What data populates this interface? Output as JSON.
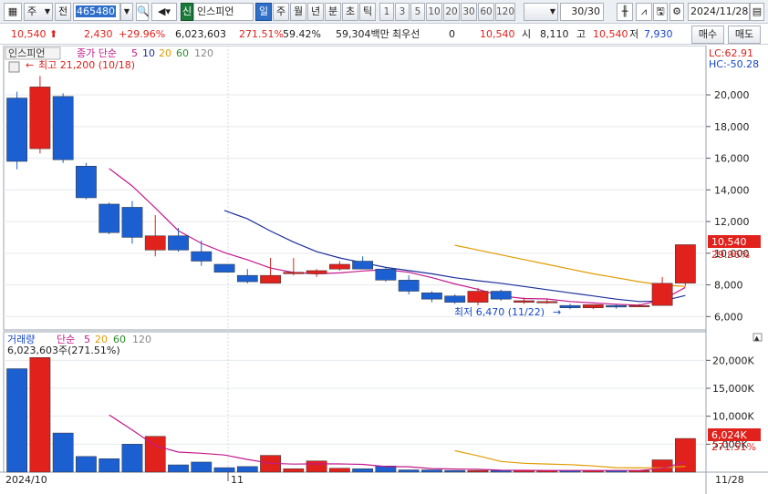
{
  "toolbar": {
    "type_label": "주",
    "prev_label": "전",
    "stock_code": "465480",
    "stock_badge": "신",
    "stock_name": "인스피언",
    "period_tabs": [
      "일",
      "주",
      "월",
      "년",
      "분",
      "초",
      "틱"
    ],
    "period_active": "일",
    "interval_buttons": [
      "1",
      "3",
      "5",
      "10",
      "20",
      "30",
      "60",
      "120"
    ],
    "count_display": "30/30",
    "date_value": "2024/11/28"
  },
  "quote": {
    "price": "10,540",
    "change": "2,430",
    "change_pct": "+29.96%",
    "volume": "6,023,603",
    "volume_ratio": "271.51%",
    "turnover": "59.42%",
    "amount": "59,304백만",
    "priority_label": "최우선",
    "priority_value": "0",
    "bid": "10,540",
    "open_label": "시",
    "open": "8,110",
    "high_label": "고",
    "high": "10,540",
    "low_label": "저",
    "low": "7,930",
    "buy_label": "매수",
    "sell_label": "매도"
  },
  "price_panel": {
    "name_tag": "인스피언",
    "ma_label": "종가 단순",
    "ma_periods": [
      "5",
      "10",
      "20",
      "60",
      "120"
    ],
    "ma_colors": [
      "#c4198c",
      "#1c2f9c",
      "#e29b00",
      "#2d8b2d",
      "#888888"
    ],
    "high_annotation": "최고 21,200 (10/18)",
    "low_annotation": "최저 6,470 (11/22)",
    "lc_label": "LC:62.91",
    "hc_label": "HC:-50.28",
    "y_ticks": [
      "20,000",
      "18,000",
      "16,000",
      "14,000",
      "12,000",
      "10,000",
      "8,000",
      "6,000"
    ],
    "last_price_tag": "10,540",
    "last_pct_tag": "29.96%"
  },
  "volume_panel": {
    "title": "거래량",
    "ma_label": "단순",
    "ma_periods": [
      "5",
      "20",
      "60",
      "120"
    ],
    "volume_annotation": "6,023,603주(271.51%)",
    "y_ticks": [
      "20,000K",
      "15,000K",
      "10,000K",
      "5,000K"
    ],
    "last_vol_tag": "6,024K",
    "last_pct_tag": "271.51%"
  },
  "x_axis": {
    "labels": [
      "2024/10",
      "11",
      "11/28"
    ]
  },
  "chart_data": {
    "type": "candlestick",
    "candles": [
      {
        "o": 19800,
        "h": 20200,
        "l": 15300,
        "c": 15800,
        "v": 18500
      },
      {
        "o": 16600,
        "h": 21200,
        "l": 16300,
        "c": 20500,
        "v": 20500
      },
      {
        "o": 19900,
        "h": 20100,
        "l": 15700,
        "c": 15900,
        "v": 7000
      },
      {
        "o": 15500,
        "h": 15700,
        "l": 13400,
        "c": 13500,
        "v": 2800
      },
      {
        "o": 13100,
        "h": 13200,
        "l": 11200,
        "c": 11300,
        "v": 2400
      },
      {
        "o": 12900,
        "h": 13300,
        "l": 10600,
        "c": 11000,
        "v": 5000
      },
      {
        "o": 10200,
        "h": 12400,
        "l": 9800,
        "c": 11100,
        "v": 6400
      },
      {
        "o": 11100,
        "h": 11600,
        "l": 10100,
        "c": 10200,
        "v": 1300
      },
      {
        "o": 10100,
        "h": 10800,
        "l": 9200,
        "c": 9500,
        "v": 1800
      },
      {
        "o": 9300,
        "h": 9300,
        "l": 8800,
        "c": 8800,
        "v": 800
      },
      {
        "o": 8600,
        "h": 9000,
        "l": 8100,
        "c": 8200,
        "v": 1000
      },
      {
        "o": 8100,
        "h": 9700,
        "l": 8100,
        "c": 8600,
        "v": 3000
      },
      {
        "o": 8700,
        "h": 9700,
        "l": 8600,
        "c": 8800,
        "v": 600
      },
      {
        "o": 8700,
        "h": 9000,
        "l": 8500,
        "c": 8900,
        "v": 2000
      },
      {
        "o": 9000,
        "h": 9500,
        "l": 8900,
        "c": 9300,
        "v": 700
      },
      {
        "o": 9500,
        "h": 9800,
        "l": 9000,
        "c": 9000,
        "v": 600
      },
      {
        "o": 9000,
        "h": 9100,
        "l": 8200,
        "c": 8300,
        "v": 1100
      },
      {
        "o": 8300,
        "h": 8600,
        "l": 7400,
        "c": 7600,
        "v": 400
      },
      {
        "o": 7500,
        "h": 7600,
        "l": 6900,
        "c": 7100,
        "v": 400
      },
      {
        "o": 7300,
        "h": 7400,
        "l": 6800,
        "c": 6900,
        "v": 300
      },
      {
        "o": 6900,
        "h": 7800,
        "l": 6700,
        "c": 7600,
        "v": 300
      },
      {
        "o": 7600,
        "h": 7700,
        "l": 7000,
        "c": 7100,
        "v": 300
      },
      {
        "o": 6900,
        "h": 7200,
        "l": 6800,
        "c": 7000,
        "v": 300
      },
      {
        "o": 6950,
        "h": 7100,
        "l": 6800,
        "c": 6950,
        "v": 300
      },
      {
        "o": 6700,
        "h": 6800,
        "l": 6470,
        "c": 6550,
        "v": 300
      },
      {
        "o": 6550,
        "h": 6750,
        "l": 6470,
        "c": 6750,
        "v": 300
      },
      {
        "o": 6700,
        "h": 6800,
        "l": 6500,
        "c": 6600,
        "v": 300
      },
      {
        "o": 6650,
        "h": 6800,
        "l": 6600,
        "c": 6700,
        "v": 300
      },
      {
        "o": 6700,
        "h": 8500,
        "l": 6700,
        "c": 8100,
        "v": 2200
      },
      {
        "o": 8110,
        "h": 10540,
        "l": 7930,
        "c": 10540,
        "v": 6024
      }
    ],
    "ma5": [
      null,
      null,
      null,
      null,
      15350,
      14240,
      12860,
      11420,
      10620,
      10040,
      9580,
      9060,
      8780,
      8700,
      8760,
      8880,
      8960,
      8800,
      8460,
      8060,
      7720,
      7300,
      7140,
      7110,
      6950,
      6860,
      6780,
      6720,
      7050,
      7840
    ],
    "ma10": [
      null,
      null,
      null,
      null,
      null,
      null,
      null,
      null,
      null,
      12700,
      12170,
      11400,
      10700,
      10100,
      9700,
      9400,
      9100,
      8900,
      8700,
      8450,
      8260,
      8100,
      7900,
      7700,
      7500,
      7300,
      7100,
      6950,
      6980,
      7330
    ],
    "ma20": [
      null,
      null,
      null,
      null,
      null,
      null,
      null,
      null,
      null,
      null,
      null,
      null,
      null,
      null,
      null,
      null,
      null,
      null,
      null,
      10500,
      10200,
      9900,
      9600,
      9300,
      9000,
      8700,
      8450,
      8200,
      8000,
      7900
    ],
    "ylim": [
      5500,
      21500
    ],
    "vol_ylim": [
      0,
      22500
    ]
  }
}
